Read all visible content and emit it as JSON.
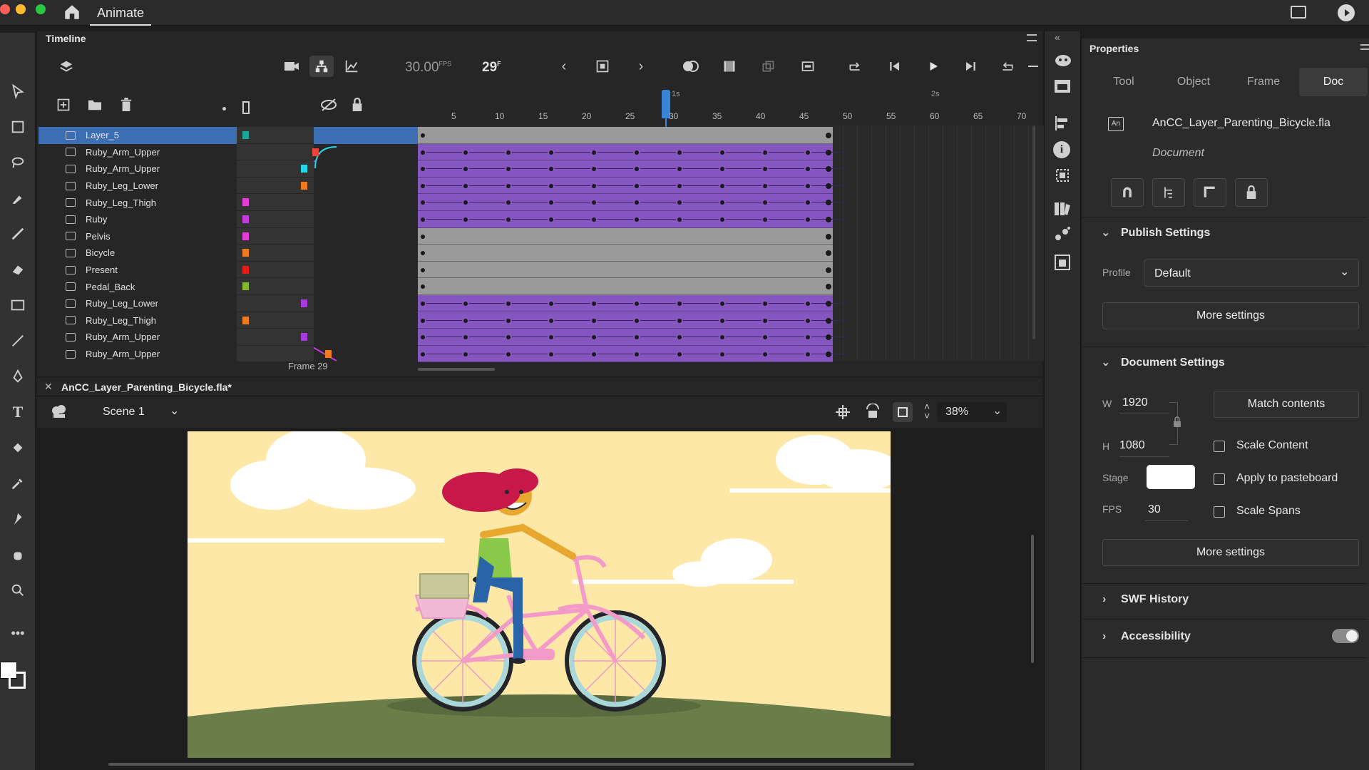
{
  "app": {
    "tab_label": "Animate"
  },
  "timeline": {
    "title": "Timeline",
    "fps": "30.00",
    "fps_unit": "FPS",
    "frame": "29",
    "frame_unit": "F",
    "current_frame_label": "Frame 29",
    "ruler_ticks": [
      "5",
      "10",
      "15",
      "20",
      "25",
      "30",
      "35",
      "40",
      "45",
      "50",
      "55",
      "60",
      "65",
      "70"
    ],
    "second_marks": [
      "1s",
      "2s"
    ],
    "layers": [
      {
        "name": "Layer_5",
        "color": "#17a89b",
        "type": "gray",
        "selected": true
      },
      {
        "name": "Ruby_Arm_Upper",
        "color": "#e8443a",
        "type": "purple"
      },
      {
        "name": "Ruby_Arm_Upper",
        "color": "#23d8e8",
        "type": "purple"
      },
      {
        "name": "Ruby_Leg_Lower",
        "color": "#f07a1c",
        "type": "purple"
      },
      {
        "name": "Ruby_Leg_Thigh",
        "color": "#e83adb",
        "type": "purple"
      },
      {
        "name": "Ruby",
        "color": "#c23ae0",
        "type": "purple"
      },
      {
        "name": "Pelvis",
        "color": "#e83adb",
        "type": "gray"
      },
      {
        "name": "Bicycle",
        "color": "#f07a1c",
        "type": "gray"
      },
      {
        "name": "Present",
        "color": "#e81a1a",
        "type": "gray"
      },
      {
        "name": "Pedal_Back",
        "color": "#7fb82a",
        "type": "gray"
      },
      {
        "name": "Ruby_Leg_Lower",
        "color": "#a83ae0",
        "type": "purple"
      },
      {
        "name": "Ruby_Leg_Thigh",
        "color": "#f07a1c",
        "type": "purple"
      },
      {
        "name": "Ruby_Arm_Upper",
        "color": "#a83ae0",
        "type": "purple"
      },
      {
        "name": "Ruby_Arm_Upper",
        "color": "#f07a1c",
        "type": "purple"
      }
    ]
  },
  "document": {
    "tab_label": "AnCC_Layer_Parenting_Bicycle.fla*",
    "scene_label": "Scene 1",
    "zoom": "38%"
  },
  "properties": {
    "title": "Properties",
    "tabs": [
      "Tool",
      "Object",
      "Frame",
      "Doc"
    ],
    "active_tab": "Doc",
    "file_name": "AnCC_Layer_Parenting_Bicycle.fla",
    "file_type": "Document",
    "publish": {
      "header": "Publish Settings",
      "profile_label": "Profile",
      "profile_value": "Default",
      "more_settings": "More settings"
    },
    "doc_settings": {
      "header": "Document Settings",
      "w_label": "W",
      "w_value": "1920",
      "h_label": "H",
      "h_value": "1080",
      "match_contents": "Match contents",
      "scale_content": "Scale Content",
      "stage_label": "Stage",
      "stage_color": "#ffffff",
      "apply_pasteboard": "Apply to pasteboard",
      "fps_label": "FPS",
      "fps_value": "30",
      "scale_spans": "Scale Spans",
      "more_settings": "More settings"
    },
    "swf_history": "SWF History",
    "accessibility": "Accessibility"
  }
}
